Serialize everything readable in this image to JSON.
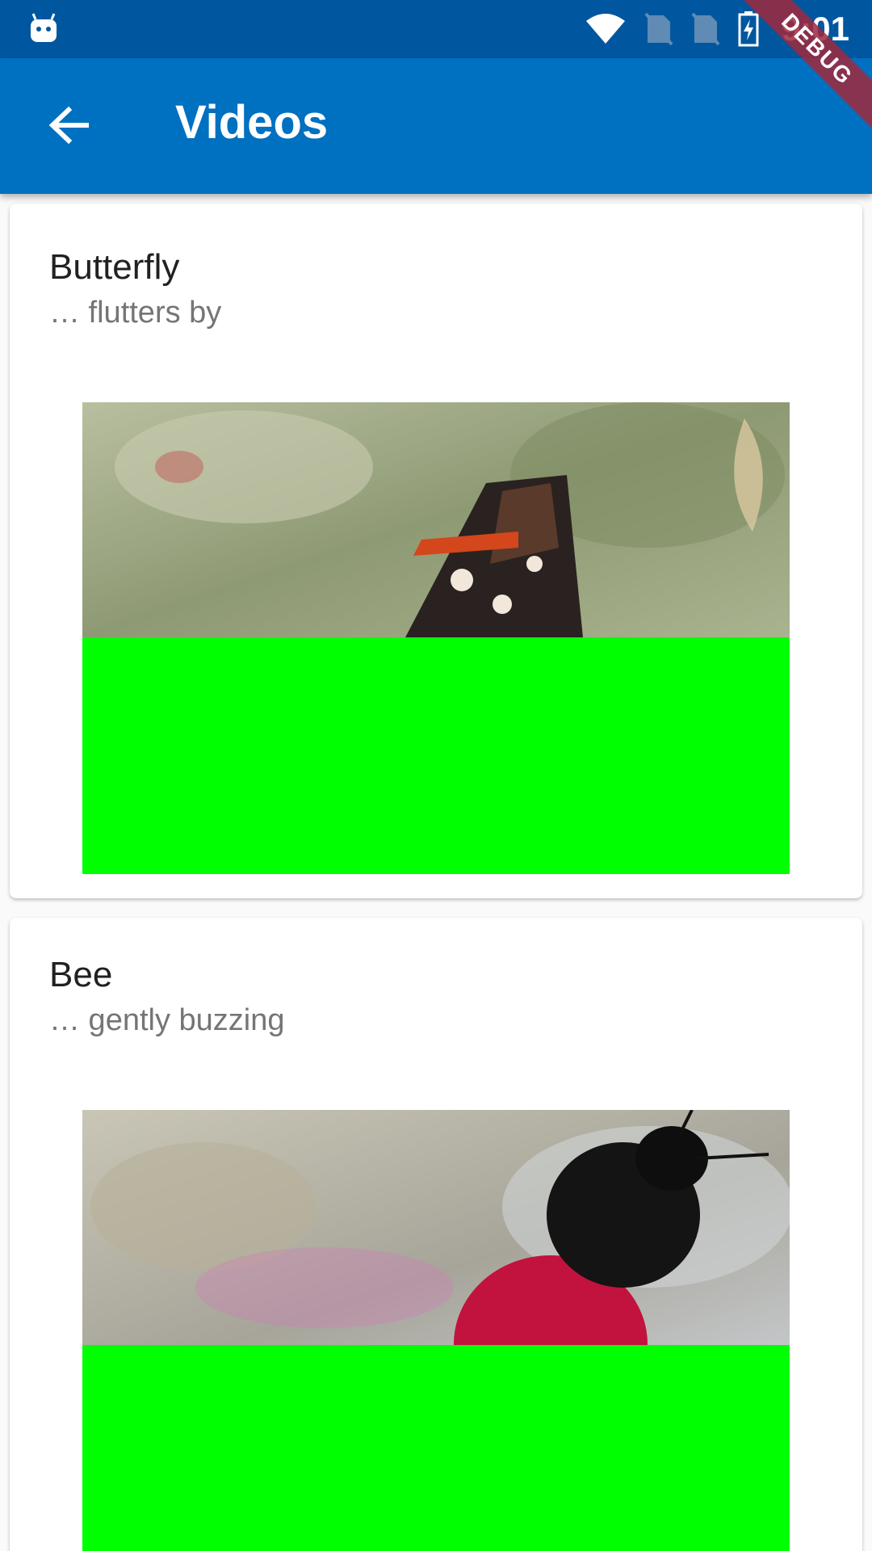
{
  "status_bar": {
    "time": "9:01",
    "icons": [
      "android-debug-icon",
      "wifi-icon",
      "no-sim-icon",
      "no-sim-icon",
      "battery-charging-icon"
    ]
  },
  "debug_banner": {
    "label": "DEBUG"
  },
  "app_bar": {
    "title": "Videos",
    "back_icon": "arrow-back-icon"
  },
  "videos": [
    {
      "title": "Butterfly",
      "subtitle": "… flutters by"
    },
    {
      "title": "Bee",
      "subtitle": "… gently buzzing"
    }
  ],
  "colors": {
    "status_bar": "#00579f",
    "app_bar": "#0070c0",
    "video_green": "#00ff00"
  }
}
